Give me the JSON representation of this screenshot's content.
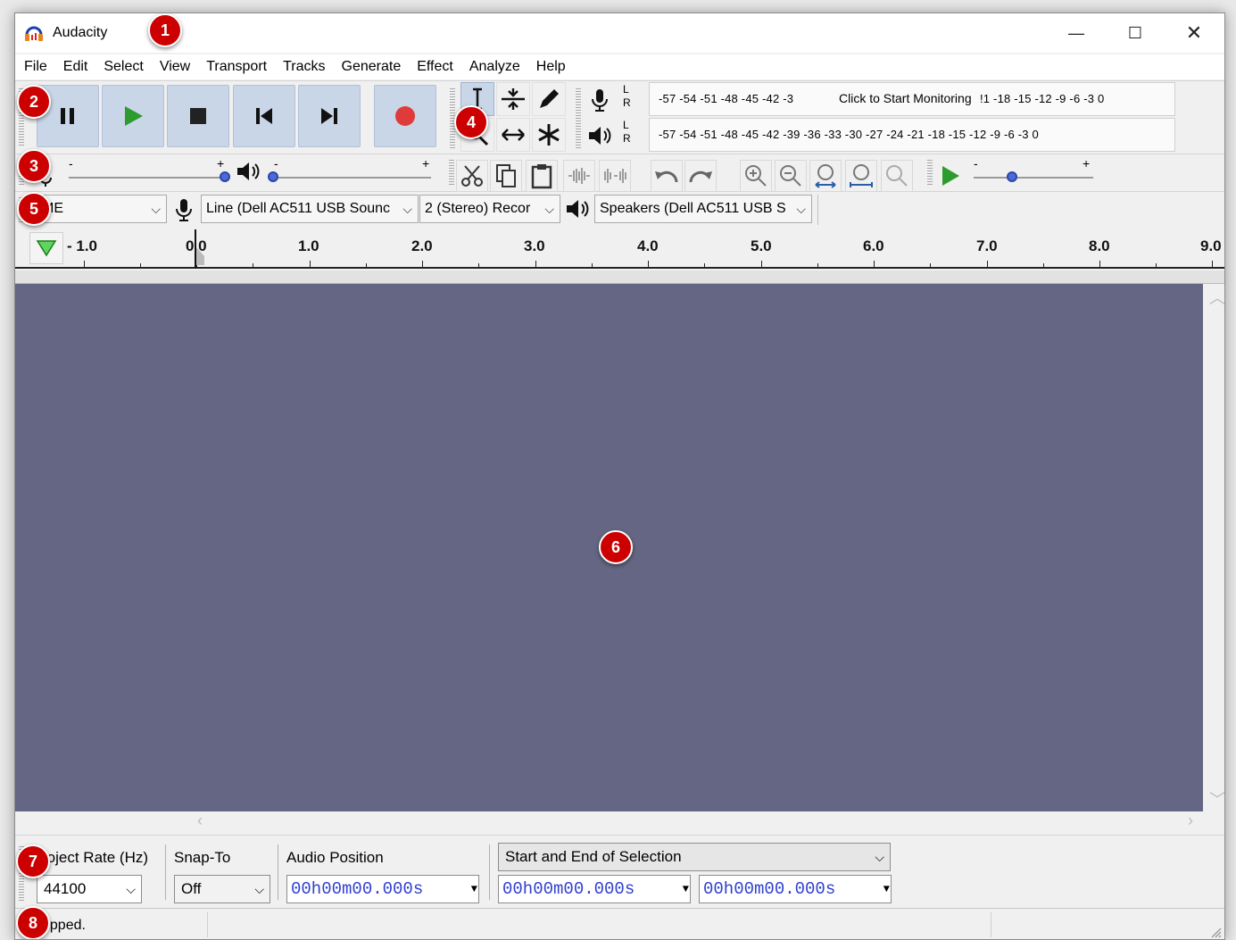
{
  "window": {
    "title": "Audacity",
    "minimize": "—",
    "maximize": "☐",
    "close": "✕"
  },
  "menu": [
    "File",
    "Edit",
    "Select",
    "View",
    "Transport",
    "Tracks",
    "Generate",
    "Effect",
    "Analyze",
    "Help"
  ],
  "meters": {
    "record_scale": "-57 -54 -51 -48 -45 -42 -3",
    "record_hint": "Click to Start Monitoring",
    "record_scale_tail": "!1 -18 -15 -12  -9   -6   -3   0",
    "play_scale": "-57 -54 -51 -48 -45 -42 -39 -36 -33 -30 -27 -24 -21 -18 -15 -12  -9   -6   -3   0",
    "L": "L",
    "R": "R"
  },
  "sliders": {
    "minus": "-",
    "plus": "+",
    "record_level": 1.0,
    "playback_level": 0.0,
    "play_speed": 0.33
  },
  "devices": {
    "host": "ME",
    "input": "Line (Dell AC511 USB Sounc",
    "channels": "2 (Stereo) Recor",
    "output": "Speakers (Dell AC511 USB S",
    "arrow": "⌵"
  },
  "timeline": {
    "labels": [
      "- 1.0",
      "0.0",
      "1.0",
      "2.0",
      "3.0",
      "4.0",
      "5.0",
      "6.0",
      "7.0",
      "8.0",
      "9.0"
    ]
  },
  "selection_toolbar": {
    "project_rate_label": "roject Rate (Hz)",
    "project_rate_value": "44100",
    "snap_label": "Snap-To",
    "snap_value": "Off",
    "audio_position_label": "Audio Position",
    "audio_position_value": "00h00m00.000s",
    "selection_mode": "Start and End of Selection",
    "selection_start": "00h00m00.000s",
    "selection_end": "00h00m00.000s"
  },
  "status": {
    "text": "opped."
  },
  "callouts": [
    "1",
    "2",
    "3",
    "4",
    "5",
    "6",
    "7",
    "8"
  ],
  "colors": {
    "track_bg": "#646683",
    "transport_btn": "#c9d6e8",
    "play_green": "#2e9b2e",
    "record_red": "#e03a3a",
    "callout_red": "#cc0000",
    "time_digits": "#2f3fcf"
  }
}
